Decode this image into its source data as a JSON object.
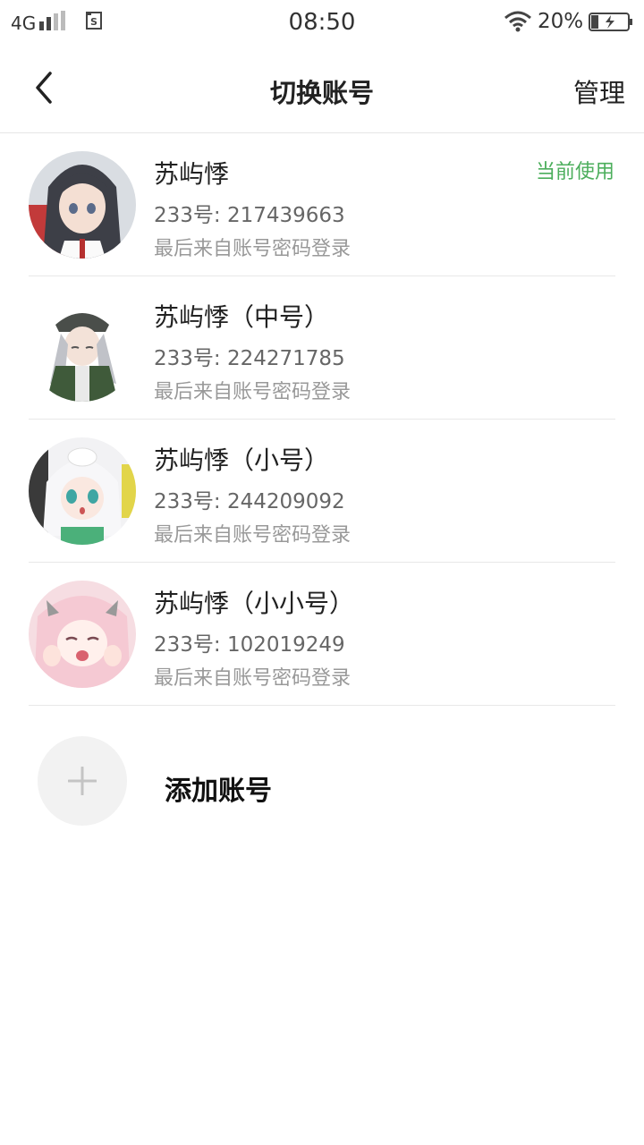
{
  "status_bar": {
    "network": "4G",
    "time": "08:50",
    "battery_percent": "20%",
    "battery_level": 0.2
  },
  "nav": {
    "title": "切换账号",
    "manage_label": "管理"
  },
  "accounts": [
    {
      "name": "苏屿悸",
      "id_text": "233号: 217439663",
      "login_text": "最后来自账号密码登录",
      "current_label": "当前使用"
    },
    {
      "name": "苏屿悸（中号）",
      "id_text": "233号: 224271785",
      "login_text": "最后来自账号密码登录"
    },
    {
      "name": "苏屿悸（小号）",
      "id_text": "233号: 244209092",
      "login_text": "最后来自账号密码登录"
    },
    {
      "name": "苏屿悸（小小号）",
      "id_text": "233号: 102019249",
      "login_text": "最后来自账号密码登录"
    }
  ],
  "add_account": {
    "label": "添加账号",
    "icon": "plus-icon"
  },
  "colors": {
    "accent_green": "#4cae5c",
    "divider": "#e8e8e8"
  }
}
